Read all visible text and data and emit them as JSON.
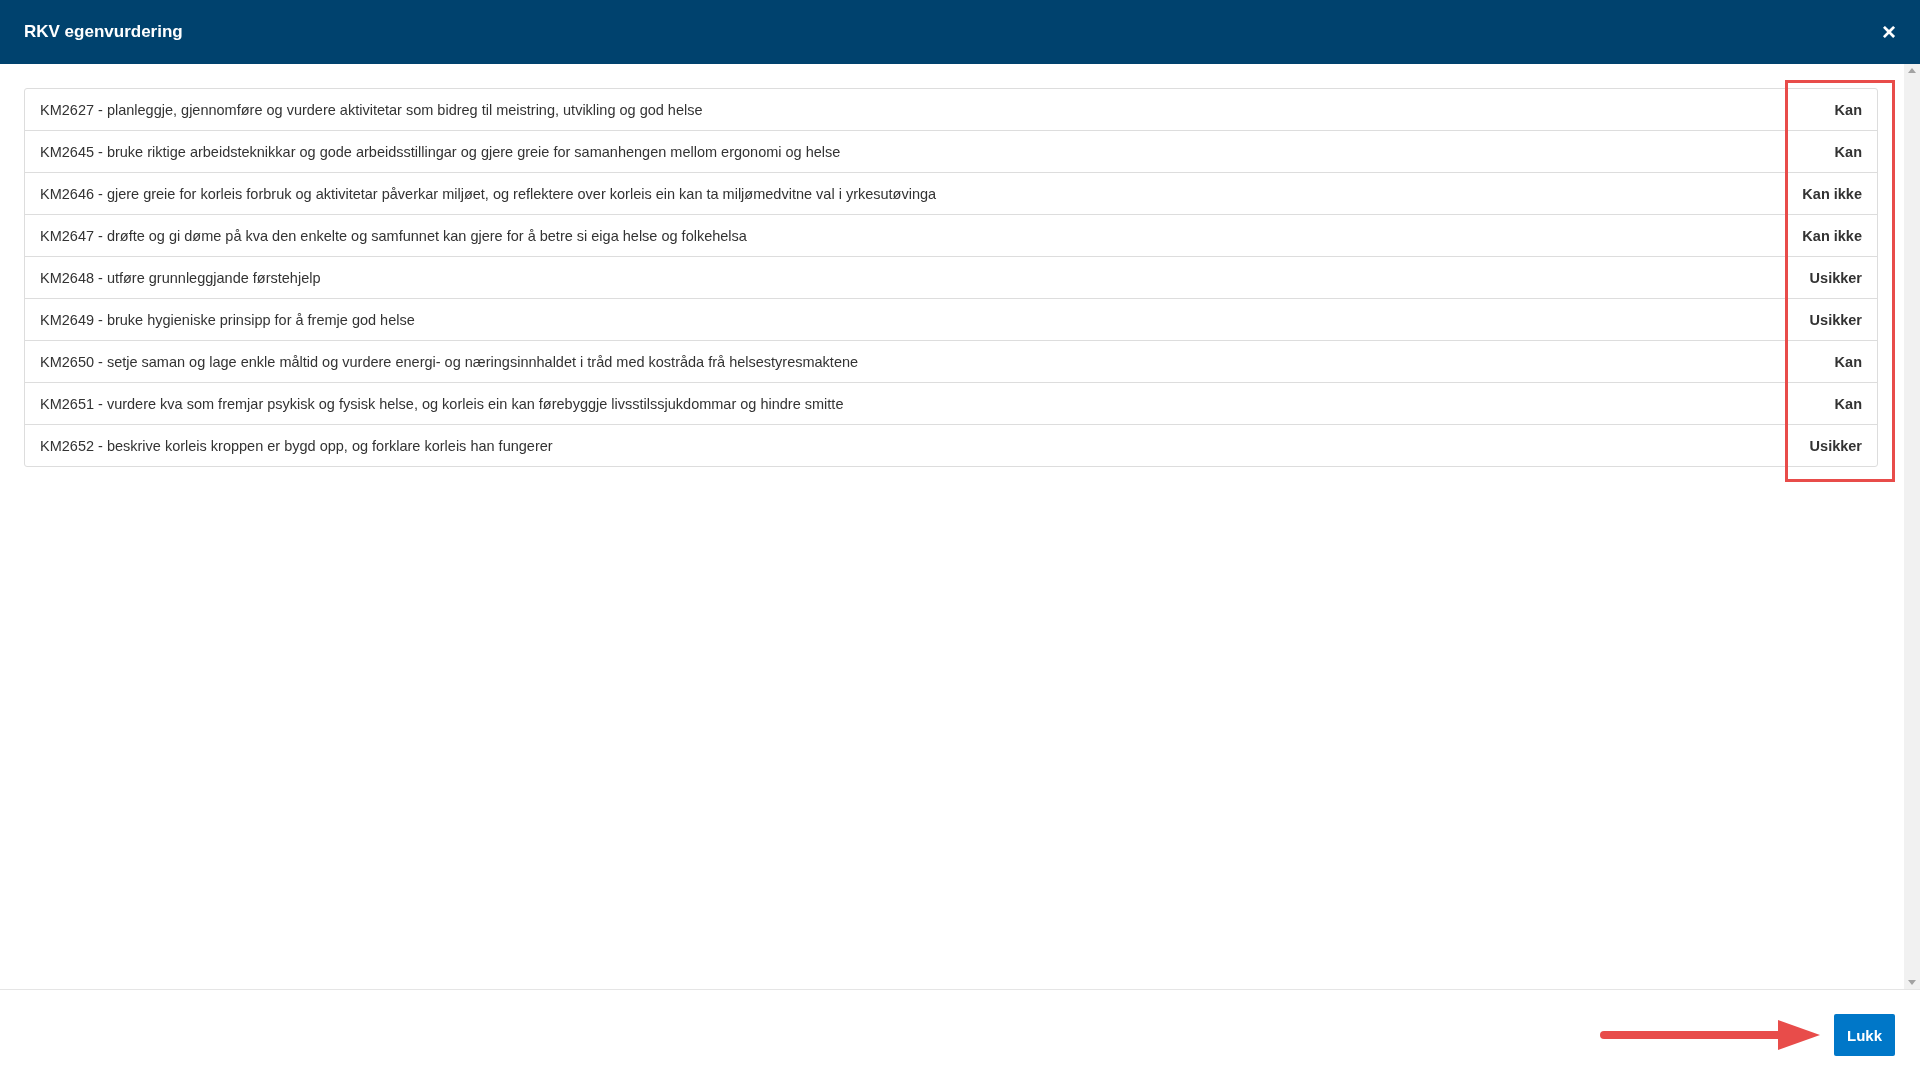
{
  "dialog": {
    "title": "RKV egenvurdering",
    "close": "×"
  },
  "rows": [
    {
      "text": "KM2627 - planleggje, gjennomføre og vurdere aktivitetar som bidreg til meistring, utvikling og god helse",
      "answer": "Kan"
    },
    {
      "text": "KM2645 - bruke riktige arbeidsteknikkar og gode arbeidsstillingar og gjere greie for samanhengen mellom ergonomi og helse",
      "answer": "Kan"
    },
    {
      "text": "KM2646 - gjere greie for korleis forbruk og aktivitetar påverkar miljøet, og reflektere over korleis ein kan ta miljømedvitne val i yrkesutøvinga",
      "answer": "Kan ikke"
    },
    {
      "text": "KM2647 - drøfte og gi døme på kva den enkelte og samfunnet kan gjere for å betre si eiga helse og folkehelsa",
      "answer": "Kan ikke"
    },
    {
      "text": "KM2648 - utføre grunnleggjande førstehjelp",
      "answer": "Usikker"
    },
    {
      "text": "KM2649 - bruke hygieniske prinsipp for å fremje god helse",
      "answer": "Usikker"
    },
    {
      "text": "KM2650 - setje saman og lage enkle måltid og vurdere energi- og næringsinnhaldet i tråd med kostråda frå helsestyresmaktene",
      "answer": "Kan"
    },
    {
      "text": "KM2651 - vurdere kva som fremjar psykisk og fysisk helse, og korleis ein kan førebyggje livsstilssjukdommar og hindre smitte",
      "answer": "Kan"
    },
    {
      "text": "KM2652 - beskrive korleis kroppen er bygd opp, og forklare korleis han fungerer",
      "answer": "Usikker"
    }
  ],
  "footer": {
    "button": "Lukk"
  }
}
